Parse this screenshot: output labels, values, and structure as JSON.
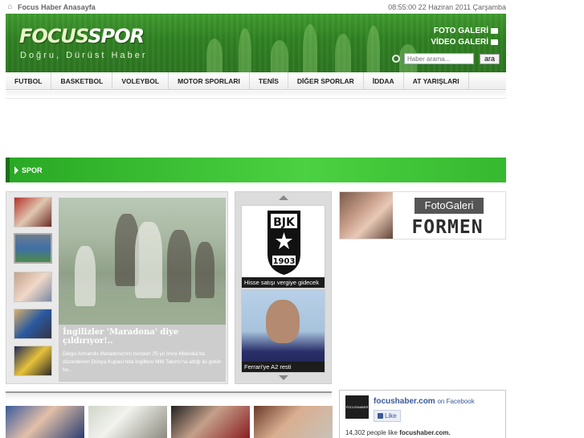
{
  "topbar": {
    "home_label": "Focus Haber Anasayfa",
    "datetime": "08:55:00  22 Haziran 2011 Çarşamba"
  },
  "header": {
    "logo_part1": "FOCUS",
    "logo_part2": "SPOR",
    "slogan": "Doğru, Dürüst Haber",
    "foto_galeri": "FOTO GALERİ",
    "video_galeri": "VİDEO GALERİ",
    "search_placeholder": "Haber arama...",
    "search_button": "ara"
  },
  "nav": {
    "items": [
      {
        "label": "FUTBOL"
      },
      {
        "label": "BASKETBOL"
      },
      {
        "label": "VOLEYBOL"
      },
      {
        "label": "MOTOR SPORLARI"
      },
      {
        "label": "TENİS"
      },
      {
        "label": "DİĞER SPORLAR"
      },
      {
        "label": "İDDAA"
      },
      {
        "label": "AT YARIŞLARI"
      }
    ]
  },
  "section": {
    "title": "SPOR"
  },
  "slider": {
    "headline": "İngilizler 'Maradona' diye çıldırıyor!..",
    "summary": "Diego Armando Maradona'nın bundan 25 yıl önce Meksika'da düzenlenen Dünya Kupası'nda İngiltere Milli Takımı'na attığı iki golün bu..."
  },
  "scroller": {
    "cards": [
      {
        "title": "Hisse satışı vergiye gidecek"
      },
      {
        "title": "Ferrari'ye A2 resti"
      }
    ],
    "club_letters": "BJK",
    "club_year": "1903"
  },
  "ad": {
    "label_top": "FotoGaleri",
    "label_bottom": "FORMEN"
  },
  "facebook": {
    "page_name": "focushaber.com",
    "on_facebook": "on Facebook",
    "like_label": "Like",
    "logo_text": "FOCUSHABER",
    "count_text": "14,302 people like",
    "count_site": "focushaber.com."
  },
  "colors": {
    "brand_green": "#2f7f22",
    "section_green": "#36b82f",
    "facebook_blue": "#3b5998"
  }
}
